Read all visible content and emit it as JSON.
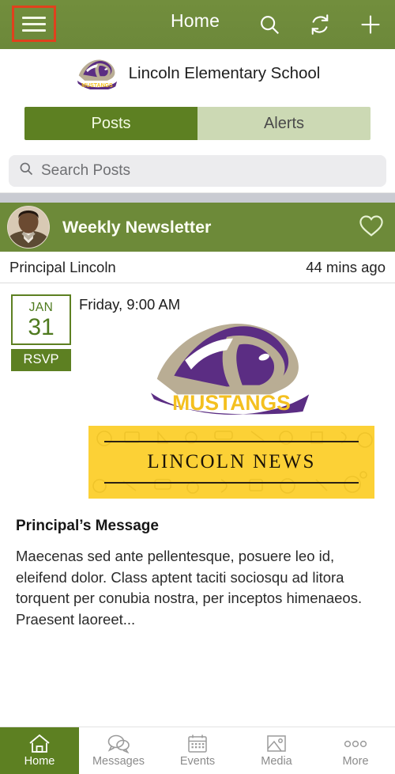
{
  "topbar": {
    "title": "Home",
    "menu_icon": "hamburger-menu-icon",
    "search_icon": "search-icon",
    "refresh_icon": "refresh-icon",
    "add_icon": "plus-icon",
    "background_color": "#6d8a39",
    "highlight_color": "#e0411d"
  },
  "school": {
    "name": "Lincoln Elementary School",
    "logo_icon": "mustangs-logo-icon"
  },
  "tabs": {
    "items": [
      {
        "label": "Posts",
        "active": true
      },
      {
        "label": "Alerts",
        "active": false
      }
    ],
    "active_color": "#5d8022",
    "inactive_color": "#ccd9b4"
  },
  "search": {
    "placeholder": "Search Posts",
    "value": "",
    "icon": "search-icon"
  },
  "post": {
    "avatar_icon": "user-avatar",
    "title": "Weekly Newsletter",
    "favorite_icon": "heart-outline-icon",
    "author": "Principal Lincoln",
    "timestamp": "44 mins ago",
    "event": {
      "month": "JAN",
      "day": "31",
      "rsvp_label": "RSVP",
      "when": "Friday, 9:00 AM"
    },
    "images": [
      {
        "name": "mustangs-logo-image",
        "alt": "MUSTANGS"
      },
      {
        "name": "lincoln-news-banner-image",
        "alt": "LINCOLN NEWS"
      }
    ],
    "banner_text": "LINCOLN NEWS",
    "banner_color": "#fcd136",
    "section_title": "Principal’s Message",
    "body": "Maecenas sed ante pellentesque, posuere leo id, eleifend dolor. Class aptent taciti sociosqu ad litora torquent per conubia nostra, per inceptos himenaeos. Praesent laoreet..."
  },
  "bottomnav": {
    "items": [
      {
        "label": "Home",
        "icon": "home-icon",
        "active": true
      },
      {
        "label": "Messages",
        "icon": "chat-bubbles-icon",
        "active": false
      },
      {
        "label": "Events",
        "icon": "calendar-icon",
        "active": false
      },
      {
        "label": "Media",
        "icon": "image-icon",
        "active": false
      },
      {
        "label": "More",
        "icon": "ellipsis-icon",
        "active": false
      }
    ],
    "active_color": "#5d8022"
  }
}
